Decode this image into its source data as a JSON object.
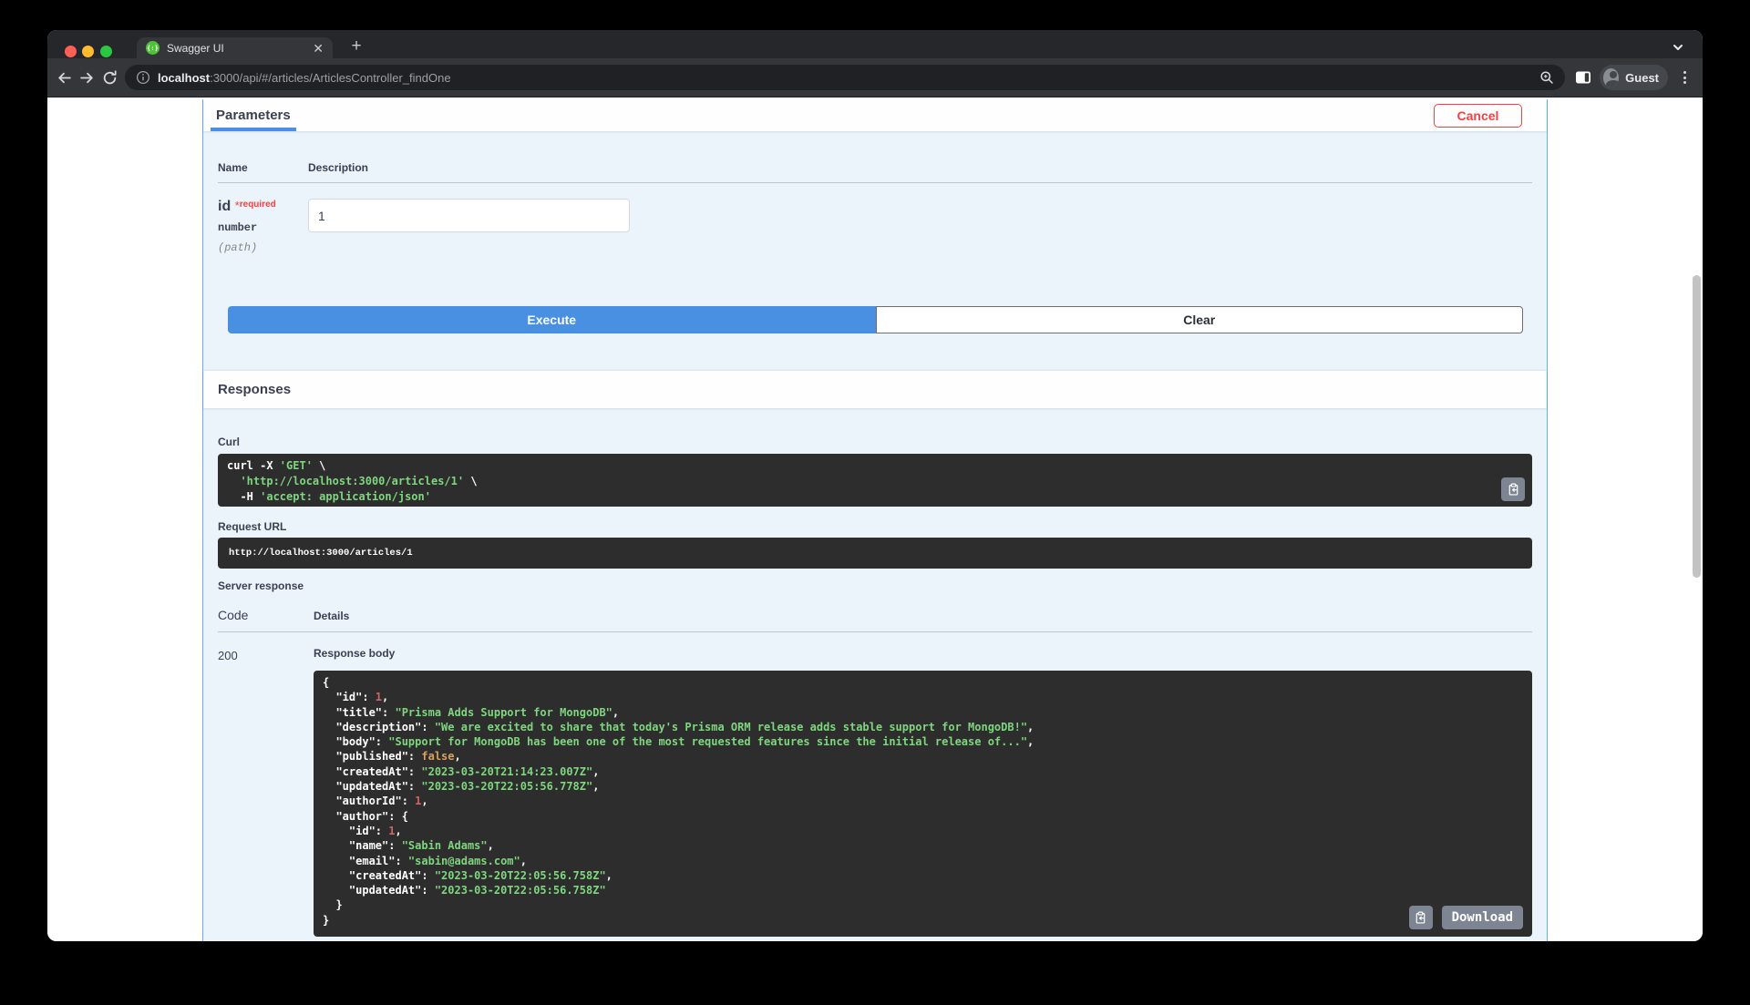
{
  "browser": {
    "tab": {
      "title": "Swagger UI",
      "favicon_glyph": "{:}"
    },
    "url": {
      "host": "localhost",
      "rest": ":3000/api/#/articles/ArticlesController_findOne"
    },
    "profile_label": "Guest",
    "icons": [
      "back-icon",
      "forward-icon",
      "reload-icon",
      "site-info-icon",
      "zoom-icon",
      "side-panel-icon",
      "avatar",
      "menu-dots-icon",
      "tab-search-chevron-icon",
      "new-tab-icon",
      "tab-close-icon"
    ],
    "colors": {
      "accent_blue": "#4990e2",
      "tab_bg": "#35363a",
      "frame_bg": "#26272b"
    }
  },
  "swagger": {
    "parameters_section": {
      "tab_label": "Parameters",
      "cancel_label": "Cancel",
      "columns": {
        "name": "Name",
        "description": "Description"
      },
      "param": {
        "name": "id",
        "required_marker": "*",
        "required_label": "required",
        "type": "number",
        "location": "(path)",
        "value": "1"
      },
      "execute_label": "Execute",
      "clear_label": "Clear"
    },
    "responses_section": {
      "title": "Responses",
      "curl_label": "Curl",
      "curl_lines": [
        [
          {
            "t": "curl -X ",
            "c": "w"
          },
          {
            "t": "'GET'",
            "c": "g"
          },
          {
            "t": " \\",
            "c": "w"
          }
        ],
        [
          {
            "t": "  ",
            "c": "w"
          },
          {
            "t": "'http://localhost:3000/articles/1'",
            "c": "g"
          },
          {
            "t": " \\",
            "c": "w"
          }
        ],
        [
          {
            "t": "  -H ",
            "c": "w"
          },
          {
            "t": "'accept: application/json'",
            "c": "g"
          }
        ]
      ],
      "request_url_label": "Request URL",
      "request_url": "http://localhost:3000/articles/1",
      "server_response_label": "Server response",
      "code_header": "Code",
      "details_header": "Details",
      "status_code": "200",
      "response_body_label": "Response body",
      "download_label": "Download",
      "response_json_lines": [
        [
          {
            "t": "{",
            "c": "w"
          }
        ],
        [
          {
            "t": "  \"id\": ",
            "c": "w"
          },
          {
            "t": "1",
            "c": "n"
          },
          {
            "t": ",",
            "c": "w"
          }
        ],
        [
          {
            "t": "  \"title\": ",
            "c": "w"
          },
          {
            "t": "\"Prisma Adds Support for MongoDB\"",
            "c": "g"
          },
          {
            "t": ",",
            "c": "w"
          }
        ],
        [
          {
            "t": "  \"description\": ",
            "c": "w"
          },
          {
            "t": "\"We are excited to share that today's Prisma ORM release adds stable support for MongoDB!\"",
            "c": "g"
          },
          {
            "t": ",",
            "c": "w"
          }
        ],
        [
          {
            "t": "  \"body\": ",
            "c": "w"
          },
          {
            "t": "\"Support for MongoDB has been one of the most requested features since the initial release of...\"",
            "c": "g"
          },
          {
            "t": ",",
            "c": "w"
          }
        ],
        [
          {
            "t": "  \"published\": ",
            "c": "w"
          },
          {
            "t": "false",
            "c": "b"
          },
          {
            "t": ",",
            "c": "w"
          }
        ],
        [
          {
            "t": "  \"createdAt\": ",
            "c": "w"
          },
          {
            "t": "\"2023-03-20T21:14:23.007Z\"",
            "c": "g"
          },
          {
            "t": ",",
            "c": "w"
          }
        ],
        [
          {
            "t": "  \"updatedAt\": ",
            "c": "w"
          },
          {
            "t": "\"2023-03-20T22:05:56.778Z\"",
            "c": "g"
          },
          {
            "t": ",",
            "c": "w"
          }
        ],
        [
          {
            "t": "  \"authorId\": ",
            "c": "w"
          },
          {
            "t": "1",
            "c": "n"
          },
          {
            "t": ",",
            "c": "w"
          }
        ],
        [
          {
            "t": "  \"author\": {",
            "c": "w"
          }
        ],
        [
          {
            "t": "    \"id\": ",
            "c": "w"
          },
          {
            "t": "1",
            "c": "n"
          },
          {
            "t": ",",
            "c": "w"
          }
        ],
        [
          {
            "t": "    \"name\": ",
            "c": "w"
          },
          {
            "t": "\"Sabin Adams\"",
            "c": "g"
          },
          {
            "t": ",",
            "c": "w"
          }
        ],
        [
          {
            "t": "    \"email\": ",
            "c": "w"
          },
          {
            "t": "\"sabin@adams.com\"",
            "c": "g"
          },
          {
            "t": ",",
            "c": "w"
          }
        ],
        [
          {
            "t": "    \"createdAt\": ",
            "c": "w"
          },
          {
            "t": "\"2023-03-20T22:05:56.758Z\"",
            "c": "g"
          },
          {
            "t": ",",
            "c": "w"
          }
        ],
        [
          {
            "t": "    \"updatedAt\": ",
            "c": "w"
          },
          {
            "t": "\"2023-03-20T22:05:56.758Z\"",
            "c": "g"
          }
        ],
        [
          {
            "t": "  }",
            "c": "w"
          }
        ],
        [
          {
            "t": "}",
            "c": "w"
          }
        ]
      ]
    }
  }
}
